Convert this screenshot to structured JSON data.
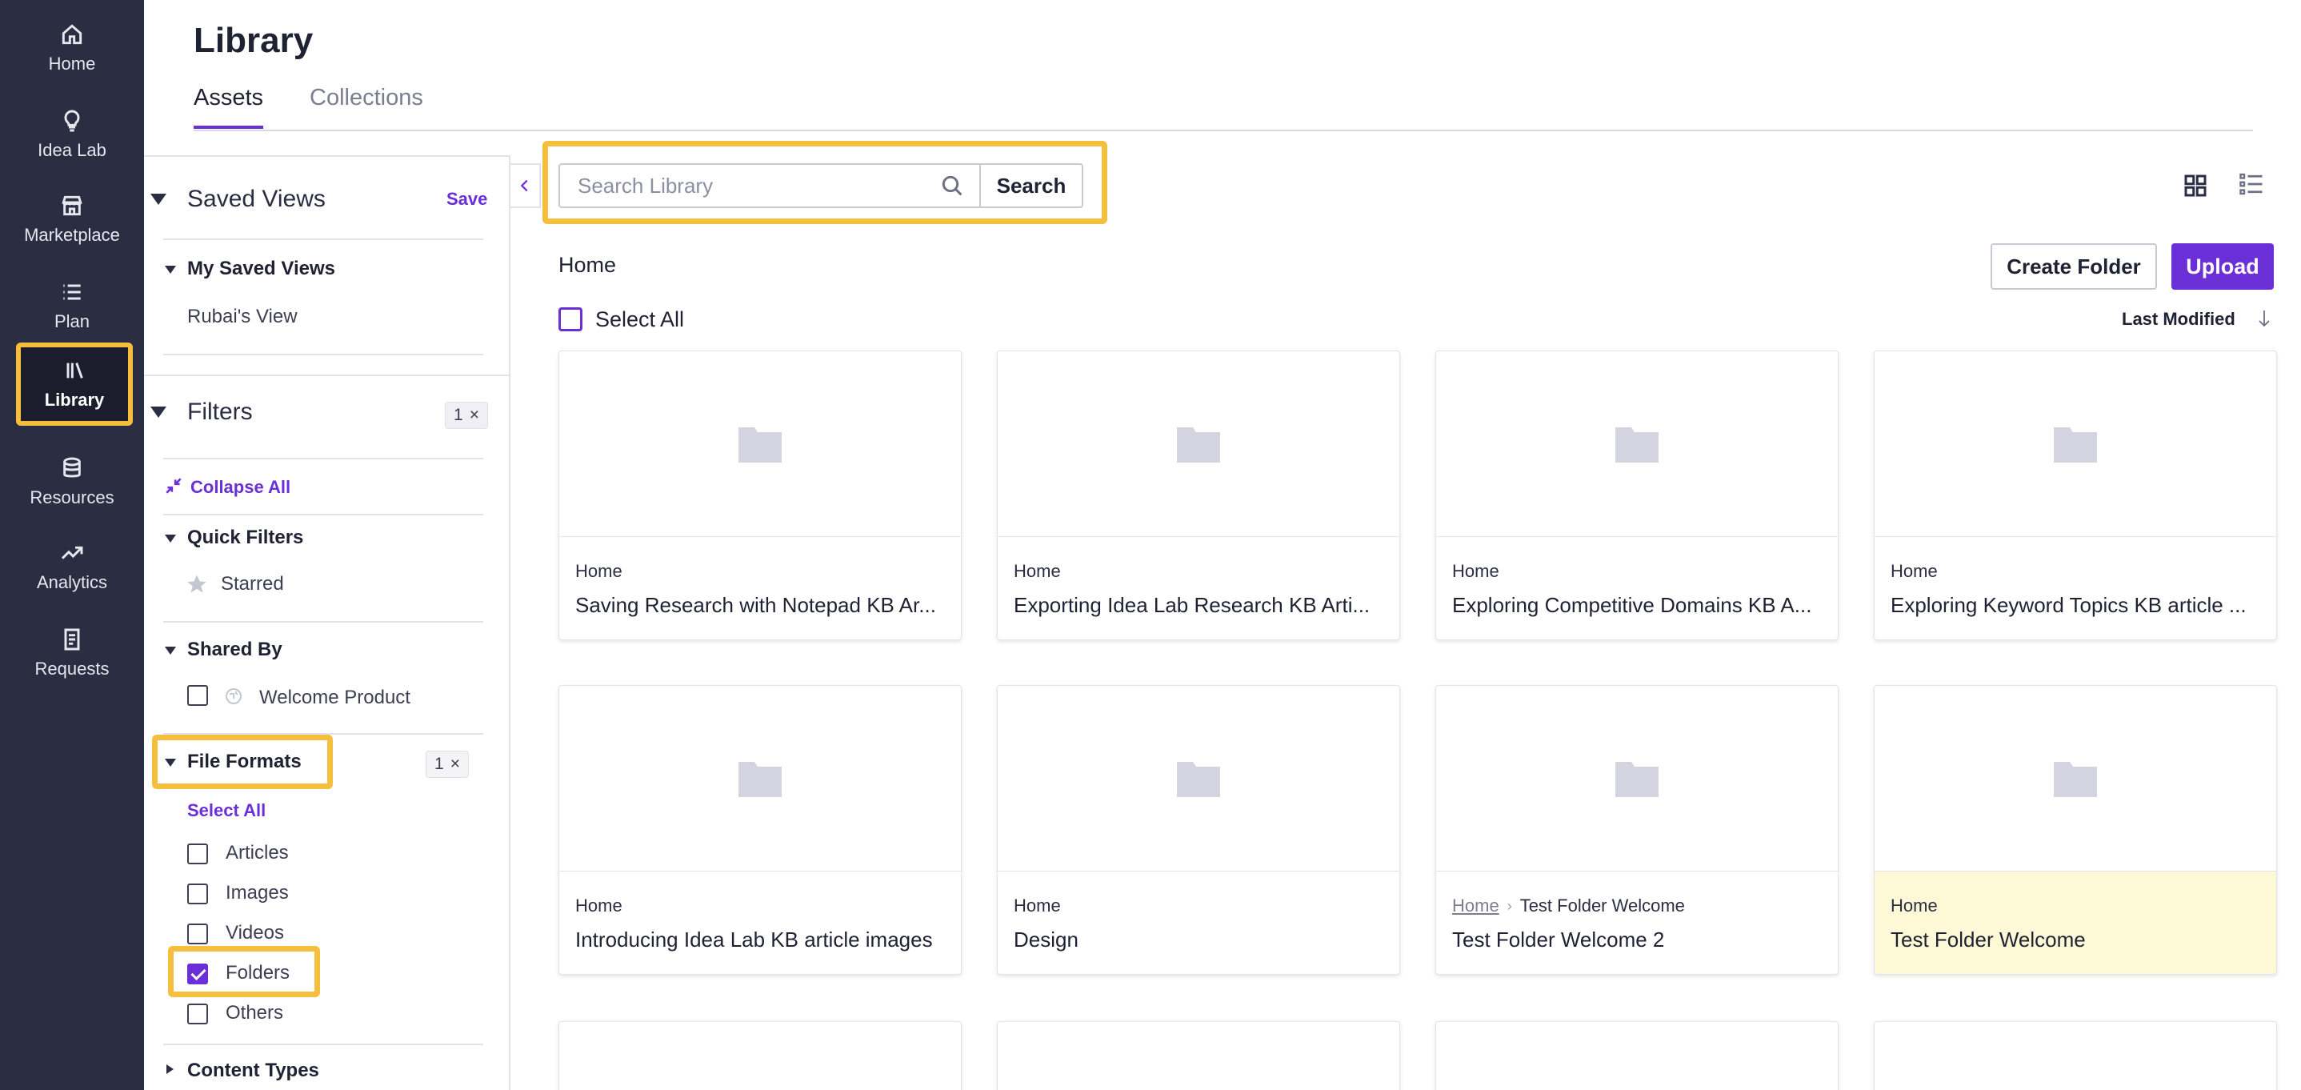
{
  "nav": {
    "items": [
      {
        "label": "Home",
        "icon": "home-icon"
      },
      {
        "label": "Idea Lab",
        "icon": "lightbulb-icon"
      },
      {
        "label": "Marketplace",
        "icon": "store-icon"
      },
      {
        "label": "Plan",
        "icon": "list-icon"
      },
      {
        "label": "Library",
        "icon": "library-icon",
        "active": true
      },
      {
        "label": "Resources",
        "icon": "database-icon"
      },
      {
        "label": "Analytics",
        "icon": "trend-icon"
      },
      {
        "label": "Requests",
        "icon": "document-icon"
      }
    ]
  },
  "header": {
    "title": "Library",
    "tabs": [
      {
        "label": "Assets",
        "active": true
      },
      {
        "label": "Collections",
        "active": false
      }
    ]
  },
  "panel": {
    "saved_views": {
      "title": "Saved Views",
      "save_label": "Save"
    },
    "my_saved_views": {
      "title": "My Saved Views",
      "items": [
        "Rubai's View"
      ]
    },
    "filters": {
      "title": "Filters",
      "count": "1",
      "clear": "×"
    },
    "collapse_all": "Collapse All",
    "quick_filters": {
      "title": "Quick Filters",
      "items": [
        "Starred"
      ]
    },
    "shared_by": {
      "title": "Shared By",
      "items": [
        "Welcome Product"
      ]
    },
    "file_formats": {
      "title": "File Formats",
      "count": "1",
      "clear": "×",
      "select_all": "Select All",
      "options": [
        {
          "label": "Articles",
          "checked": false
        },
        {
          "label": "Images",
          "checked": false
        },
        {
          "label": "Videos",
          "checked": false
        },
        {
          "label": "Folders",
          "checked": true
        },
        {
          "label": "Others",
          "checked": false
        }
      ]
    },
    "content_types": {
      "title": "Content Types"
    }
  },
  "search": {
    "placeholder": "Search Library",
    "value": "",
    "button_label": "Search"
  },
  "toolbar": {
    "breadcrumb": "Home",
    "create_folder_label": "Create Folder",
    "upload_label": "Upload",
    "select_all_label": "Select All",
    "sort_label": "Last Modified"
  },
  "colors": {
    "accent": "#6a2fd6",
    "highlight": "#f5bf3d",
    "nav_bg": "#2b2d42",
    "card_highlight": "#fdf8d5"
  },
  "cards": [
    {
      "path": [
        "Home"
      ],
      "name": "Saving Research with Notepad KB Ar..."
    },
    {
      "path": [
        "Home"
      ],
      "name": "Exporting Idea Lab Research KB Arti..."
    },
    {
      "path": [
        "Home"
      ],
      "name": "Exploring Competitive Domains KB A..."
    },
    {
      "path": [
        "Home"
      ],
      "name": "Exploring Keyword Topics KB article ..."
    },
    {
      "path": [
        "Home"
      ],
      "name": "Introducing Idea Lab KB article images"
    },
    {
      "path": [
        "Home"
      ],
      "name": "Design"
    },
    {
      "path": [
        "Home",
        "Test Folder Welcome"
      ],
      "name": "Test Folder Welcome 2"
    },
    {
      "path": [
        "Home"
      ],
      "name": "Test Folder Welcome",
      "highlighted": true
    }
  ]
}
